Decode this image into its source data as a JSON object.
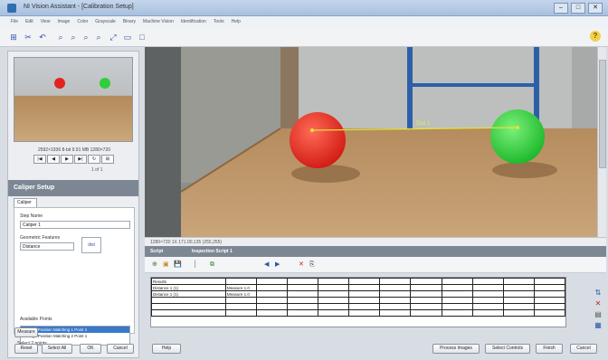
{
  "window": {
    "title": "NI Vision Assistant - [Calibration Setup]",
    "controls": [
      "–",
      "□",
      "✕"
    ]
  },
  "menu": [
    "File",
    "Edit",
    "View",
    "Image",
    "Color",
    "Grayscale",
    "Binary",
    "Machine Vision",
    "Identification",
    "Tools",
    "Help"
  ],
  "toolbar": {
    "icons": [
      "⊞",
      "✂",
      "↶",
      "⌕",
      "⌕",
      "⌕",
      "⌕",
      "⤢",
      "▭",
      "□",
      "?"
    ],
    "help_label": "?"
  },
  "thumbnail": {
    "info": "2592×1936 8-bit  9.91 MB  1280×720",
    "nav": [
      "|◀",
      "◀",
      "▶",
      "▶|",
      "↻",
      "⊞"
    ],
    "pager": "1 of 1"
  },
  "caliper": {
    "header": "Caliper Setup",
    "tab": "Caliper",
    "step_name_label": "Step Name",
    "step_name_value": "Caliper 1",
    "geometric_label": "Geometric Features",
    "geometric_value": "Distance",
    "shape_label": "dist",
    "available_points_label": "Available Points",
    "points": [
      "1. Edge Position Matching 1  Point 1",
      "2. Edge Position Matching 2  Point 1"
    ],
    "select_label": "Select 2 points",
    "measure_button": "Measure",
    "buttons": [
      "Reset",
      "Select All",
      "OK",
      "Cancel"
    ]
  },
  "viewer": {
    "annotation": "Dist 1",
    "colors": {
      "red_ball": "#e4231f",
      "green_ball": "#2fcf3b",
      "line": "#e0e23a"
    }
  },
  "statusline": "1280×720  1X  171.00,135  (255,255)",
  "script": {
    "header": "Script",
    "subheader": "Inspection Script 1",
    "tools": [
      "⊕",
      "▣",
      "💾",
      "│",
      "⧉",
      "◀",
      "▶",
      "✕",
      "⎘"
    ],
    "headers": [
      "Results"
    ],
    "rows": [
      [
        "Distance 1 (1)",
        "Measure 1.0"
      ],
      [
        "Distance 1 (1)",
        "Measure 1.0"
      ]
    ],
    "empty_cols": 11
  },
  "side_icons": [
    "⇅",
    "✕",
    "▤",
    "▦"
  ],
  "bottom": {
    "left_button": "Help",
    "right_buttons": [
      "Process Images",
      "Select Controls",
      "Finish",
      "Cancel"
    ]
  }
}
